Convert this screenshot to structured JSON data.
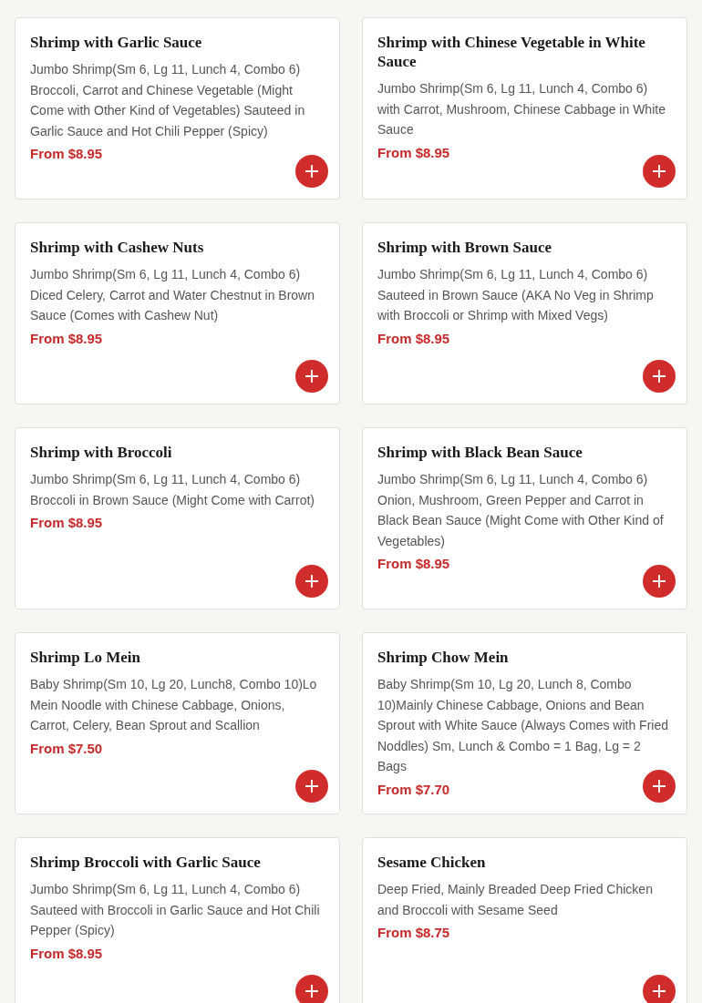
{
  "items": [
    {
      "name": "Shrimp with Garlic Sauce",
      "description": "Jumbo Shrimp(Sm 6, Lg 11, Lunch 4, Combo 6) Broccoli, Carrot and Chinese Vegetable (Might Come with Other Kind of Vegetables) Sauteed in Garlic Sauce and Hot Chili Pepper (Spicy)",
      "price": "From $8.95"
    },
    {
      "name": "Shrimp with Chinese Vegetable in White Sauce",
      "description": "Jumbo Shrimp(Sm 6, Lg 11, Lunch 4, Combo 6) with Carrot, Mushroom, Chinese Cabbage in White Sauce",
      "price": "From $8.95"
    },
    {
      "name": "Shrimp with Cashew Nuts",
      "description": "Jumbo Shrimp(Sm 6, Lg 11, Lunch 4, Combo 6) Diced Celery, Carrot and Water Chestnut in Brown Sauce (Comes with Cashew Nut)",
      "price": "From $8.95"
    },
    {
      "name": "Shrimp with Brown Sauce",
      "description": "Jumbo Shrimp(Sm 6, Lg 11, Lunch 4, Combo 6) Sauteed in Brown Sauce (AKA No Veg in Shrimp with Broccoli or Shrimp with Mixed Vegs)",
      "price": "From $8.95"
    },
    {
      "name": "Shrimp with Broccoli",
      "description": "Jumbo Shrimp(Sm 6, Lg 11, Lunch 4, Combo 6) Broccoli in Brown Sauce (Might Come with Carrot)",
      "price": "From $8.95"
    },
    {
      "name": "Shrimp with Black Bean Sauce",
      "description": "Jumbo Shrimp(Sm 6, Lg 11, Lunch 4, Combo 6) Onion, Mushroom, Green Pepper and Carrot in Black Bean Sauce (Might Come with Other Kind of Vegetables)",
      "price": "From $8.95"
    },
    {
      "name": "Shrimp Lo Mein",
      "description": "Baby Shrimp(Sm 10, Lg 20, Lunch8, Combo 10)Lo Mein Noodle with Chinese Cabbage, Onions, Carrot, Celery, Bean Sprout and Scallion",
      "price": "From $7.50"
    },
    {
      "name": "Shrimp Chow Mein",
      "description": "Baby Shrimp(Sm 10, Lg 20, Lunch 8, Combo 10)Mainly Chinese Cabbage, Onions and Bean Sprout with White Sauce (Always Comes with Fried Noddles) Sm, Lunch & Combo = 1 Bag, Lg = 2 Bags",
      "price": "From $7.70"
    },
    {
      "name": "Shrimp Broccoli with Garlic Sauce",
      "description": "Jumbo Shrimp(Sm 6, Lg 11, Lunch 4, Combo 6) Sauteed with Broccoli in Garlic Sauce and Hot Chili Pepper (Spicy)",
      "price": "From $8.95"
    },
    {
      "name": "Sesame Chicken",
      "description": "Deep Fried, Mainly Breaded Deep Fried Chicken and Broccoli with Sesame Seed",
      "price": "From $8.75"
    }
  ]
}
